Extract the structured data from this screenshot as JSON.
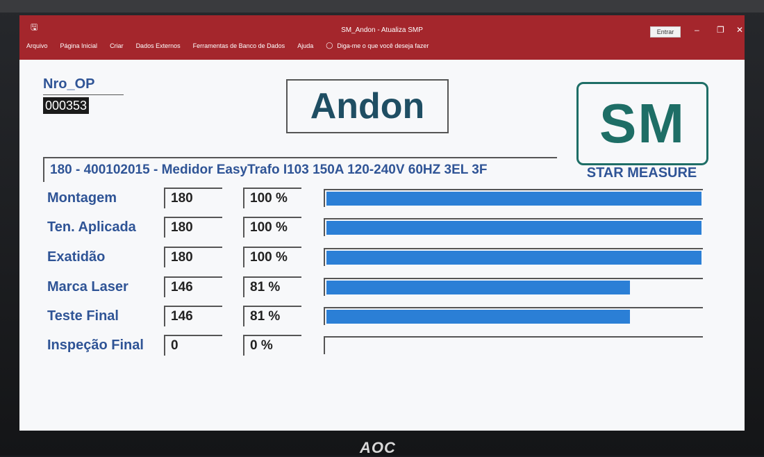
{
  "window": {
    "title": "SM_Andon - Atualiza SMP",
    "login_label": "Entrar",
    "save_icon": "save-icon"
  },
  "menu": {
    "items": [
      "Arquivo",
      "Página Inicial",
      "Criar",
      "Dados Externos",
      "Ferramentas de Banco de Dados",
      "Ajuda"
    ],
    "tell_me": "Diga-me o que você deseja fazer",
    "tell_me_icon": "lightbulb-icon"
  },
  "header": {
    "nro_op_label": "Nro_OP",
    "nro_op_value": "000353",
    "title": "Andon"
  },
  "logo": {
    "mark": "SM",
    "caption": "STAR MEASURE",
    "color": "#1e6e66"
  },
  "product": {
    "description": "180 - 400102015 - Medidor EasyTrafo I103 150A 120-240V 60HZ 3EL 3F"
  },
  "stages": [
    {
      "label": "Montagem",
      "qty": "180",
      "pct": "100 %",
      "progress": 1.0
    },
    {
      "label": "Ten. Aplicada",
      "qty": "180",
      "pct": "100 %",
      "progress": 1.0
    },
    {
      "label": "Exatidão",
      "qty": "180",
      "pct": "100 %",
      "progress": 1.0
    },
    {
      "label": "Marca Laser",
      "qty": "146",
      "pct": "81 %",
      "progress": 0.81
    },
    {
      "label": "Teste Final",
      "qty": "146",
      "pct": "81 %",
      "progress": 0.81
    },
    {
      "label": "Inspeção Final",
      "qty": "0",
      "pct": "0 %",
      "progress": 0.0
    }
  ],
  "colors": {
    "title_bar": "#a4262c",
    "label_blue": "#2f5496",
    "bar_fill": "#2b7fd6"
  },
  "monitor_brand": "AOC"
}
